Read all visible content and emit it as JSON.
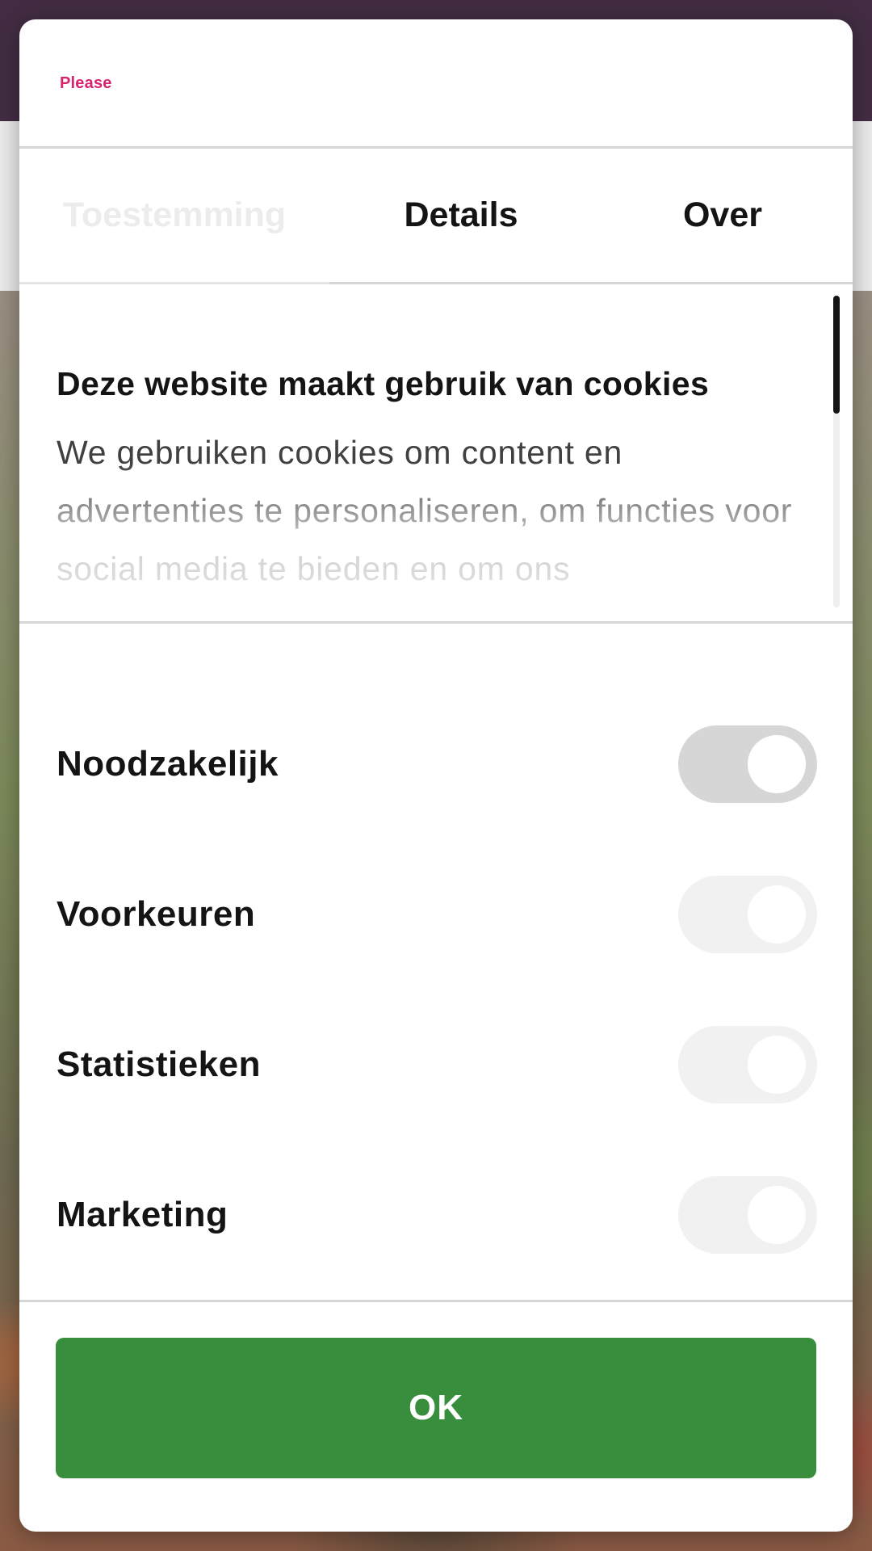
{
  "brand": {
    "logo_text": "Please"
  },
  "tabs": [
    {
      "label": "Toestemming",
      "active": true
    },
    {
      "label": "Details",
      "active": false
    },
    {
      "label": "Over",
      "active": false
    }
  ],
  "consent": {
    "title": "Deze website maakt gebruik van cookies",
    "body": "We gebruiken cookies om content en advertenties te personaliseren, om functies voor social media te bieden en om ons"
  },
  "toggles": [
    {
      "label": "Noodzakelijk",
      "state": "on-disabled"
    },
    {
      "label": "Voorkeuren",
      "state": "off"
    },
    {
      "label": "Statistieken",
      "state": "off"
    },
    {
      "label": "Marketing",
      "state": "off"
    }
  ],
  "actions": {
    "ok_label": "OK"
  },
  "colors": {
    "accent_green": "#388e3c",
    "brand_pink": "#d6246e",
    "topbar": "#432d44"
  }
}
